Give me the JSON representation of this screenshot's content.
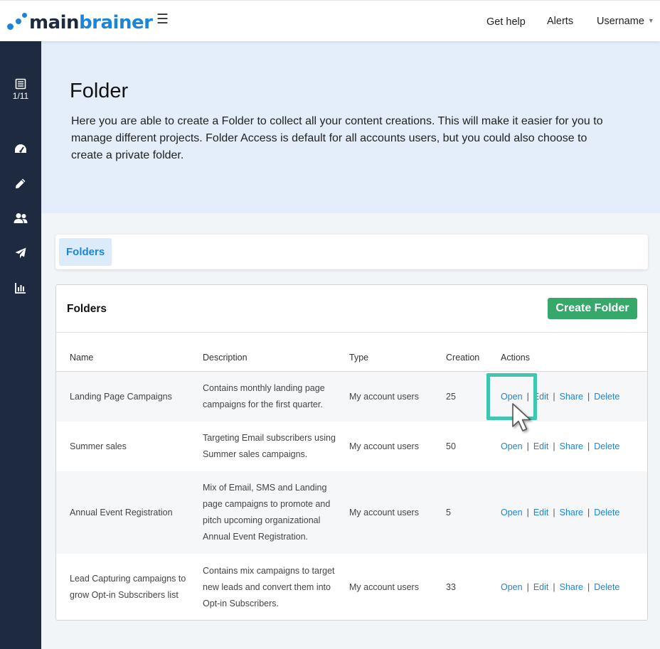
{
  "app": {
    "logo_part1": "main",
    "logo_part2": "brainer",
    "menu_icon": "hamburger-icon"
  },
  "topnav": {
    "help": "Get help",
    "alerts": "Alerts",
    "user": "Username",
    "user_caret_icon": "caret-down-icon"
  },
  "sidebar": {
    "items": [
      {
        "icon": "list-icon",
        "label": "1/11"
      },
      {
        "icon": "dashboard-icon"
      },
      {
        "icon": "pencil-icon"
      },
      {
        "icon": "users-icon"
      },
      {
        "icon": "paper-plane-icon"
      },
      {
        "icon": "bar-chart-icon"
      }
    ]
  },
  "hero": {
    "title": "Folder",
    "description": "Here you are able to create a Folder to collect all your content creations. This will make it easier for you to manage different projects. Folder Access is default for all accounts users, but you could also choose to create a private folder."
  },
  "tabs": {
    "active": "Folders"
  },
  "folders_card": {
    "title": "Folders",
    "create_button": "Create Folder",
    "columns": [
      "Name",
      "Description",
      "Type",
      "Creation",
      "Actions"
    ],
    "rows": [
      {
        "name": "Landing Page Campaigns",
        "description": "Contains monthly landing page campaigns for the first quarter.",
        "type": "My account users",
        "creation": "25"
      },
      {
        "name": "Summer sales",
        "description": "Targeting Email subscribers using Summer sales campaigns.",
        "type": "My account users",
        "creation": "50"
      },
      {
        "name": "Annual Event Registration",
        "description": "Mix of Email, SMS and Landing page campaigns to promote and pitch upcoming organizational Annual Event Registration.",
        "type": "My account users",
        "creation": "5"
      },
      {
        "name": "Lead Capturing campaigns to grow Opt-in Subscribers list",
        "description": "Contains mix campaigns to target new leads and convert them into Opt-in Subscribers.",
        "type": "My account users",
        "creation": "33"
      }
    ],
    "actions": {
      "open": "Open",
      "edit": "Edit",
      "share": "Share",
      "delete": "Delete",
      "separator": "|"
    }
  },
  "colors": {
    "accent": "#1b85d8",
    "sidebar": "#1d2a3f",
    "hero_bg": "#e3eefa",
    "create_button": "#36a86a",
    "highlight": "#3fc6ae"
  },
  "overlay": {
    "cursor_icon": "mouse-pointer-icon"
  }
}
